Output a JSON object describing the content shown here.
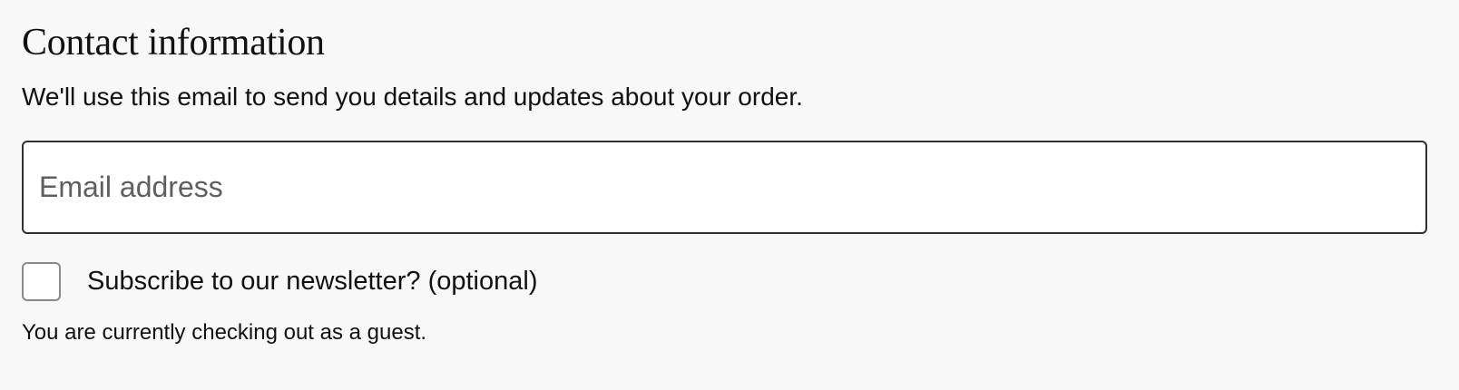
{
  "contact": {
    "title": "Contact information",
    "description": "We'll use this email to send you details and updates about your order.",
    "email": {
      "placeholder": "Email address",
      "value": ""
    },
    "newsletter": {
      "label": "Subscribe to our newsletter? (optional)",
      "checked": false
    },
    "guest_note": "You are currently checking out as a guest."
  },
  "colors": {
    "page_background": "#f8f8f8",
    "text": "#111111",
    "input_border": "#2f2f2f",
    "placeholder": "#5f5f5f",
    "checkbox_border": "#8a8a8a"
  }
}
